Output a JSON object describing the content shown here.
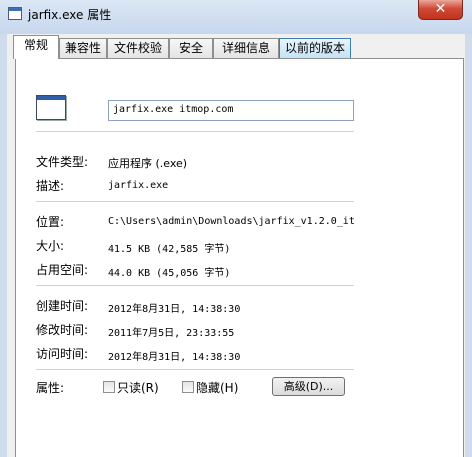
{
  "window": {
    "title": "jarfix.exe 属性",
    "close_label": "✕"
  },
  "tabs": [
    {
      "label": "常规"
    },
    {
      "label": "兼容性"
    },
    {
      "label": "文件校验"
    },
    {
      "label": "安全"
    },
    {
      "label": "详细信息"
    },
    {
      "label": "以前的版本"
    }
  ],
  "general": {
    "filename": "jarfix.exe itmop.com",
    "type_label": "文件类型:",
    "type_value": "应用程序 (.exe)",
    "desc_label": "描述:",
    "desc_value": "jarfix.exe",
    "location_label": "位置:",
    "location_value": "C:\\Users\\admin\\Downloads\\jarfix_v1.2.0_it",
    "size_label": "大小:",
    "size_value": "41.5 KB (42,585 字节)",
    "disk_label": "占用空间:",
    "disk_value": "44.0 KB (45,056 字节)",
    "created_label": "创建时间:",
    "created_value": "2012年8月31日, 14:38:30",
    "modified_label": "修改时间:",
    "modified_value": "2011年7月5日, 23:33:55",
    "accessed_label": "访问时间:",
    "accessed_value": "2012年8月31日, 14:38:30",
    "attr_label": "属性:",
    "readonly_label": "只读(R)",
    "hidden_label": "隐藏(H)",
    "advanced_label": "高级(D)..."
  }
}
